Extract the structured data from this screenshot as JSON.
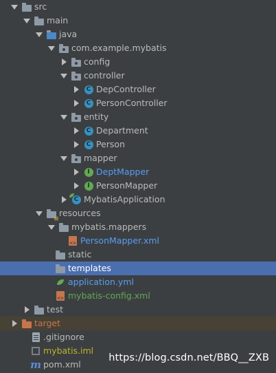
{
  "tree": [
    {
      "label": "src",
      "icon": "folder-icon",
      "expanded": true
    },
    {
      "label": "main",
      "icon": "folder-icon",
      "expanded": true
    },
    {
      "label": "java",
      "icon": "source-folder-icon",
      "expanded": true
    },
    {
      "label": "com.example.mybatis",
      "icon": "package-icon",
      "expanded": true
    },
    {
      "label": "config",
      "icon": "package-icon",
      "expanded": false
    },
    {
      "label": "controller",
      "icon": "package-icon",
      "expanded": true
    },
    {
      "label": "DepController",
      "icon": "class-icon",
      "expanded": false
    },
    {
      "label": "PersonController",
      "icon": "class-icon",
      "expanded": false
    },
    {
      "label": "entity",
      "icon": "package-icon",
      "expanded": true
    },
    {
      "label": "Department",
      "icon": "class-icon",
      "expanded": false
    },
    {
      "label": "Person",
      "icon": "class-icon",
      "expanded": false
    },
    {
      "label": "mapper",
      "icon": "package-icon",
      "expanded": true
    },
    {
      "label": "DeptMapper",
      "icon": "interface-icon",
      "expanded": false
    },
    {
      "label": "PersonMapper",
      "icon": "interface-icon",
      "expanded": false
    },
    {
      "label": "MybatisApplication",
      "icon": "spring-boot-class-icon",
      "expanded": false
    },
    {
      "label": "resources",
      "icon": "resources-folder-icon",
      "expanded": true
    },
    {
      "label": "mybatis.mappers",
      "icon": "folder-icon",
      "expanded": true
    },
    {
      "label": "PersonMapper.xml",
      "icon": "xml-file-icon"
    },
    {
      "label": "static",
      "icon": "folder-icon"
    },
    {
      "label": "templates",
      "icon": "folder-icon",
      "selected": true
    },
    {
      "label": "application.yml",
      "icon": "yaml-file-icon"
    },
    {
      "label": "mybatis-config.xml",
      "icon": "xml-file-icon"
    },
    {
      "label": "test",
      "icon": "folder-icon",
      "expanded": false
    },
    {
      "label": "target",
      "icon": "excluded-folder-icon",
      "expanded": false
    },
    {
      "label": ".gitignore",
      "icon": "text-file-icon"
    },
    {
      "label": "mybatis.iml",
      "icon": "module-file-icon"
    },
    {
      "label": "pom.xml",
      "icon": "maven-icon"
    }
  ],
  "watermark": "https://blog.csdn.net/BBQ__ZXB",
  "colors": {
    "background": "#3c3f41",
    "selection": "#4b6eaf",
    "excluded_row": "#474235",
    "text": "#bbbbbb",
    "link_blue": "#589df6",
    "vcs_green": "#62a855",
    "ignored_yellow": "#bbb529",
    "excluded_orange": "#c6754e"
  }
}
